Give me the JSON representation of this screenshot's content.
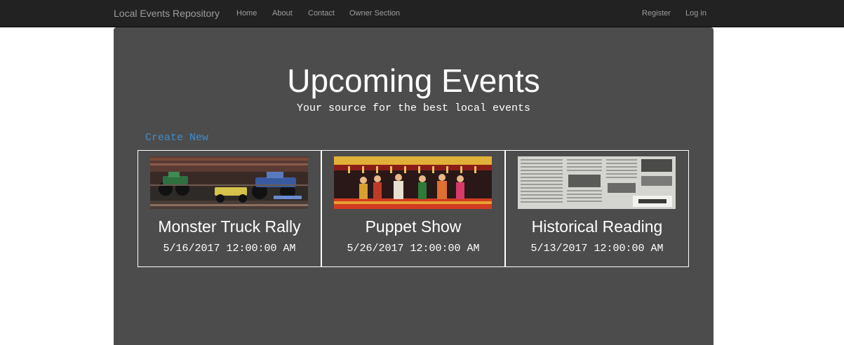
{
  "navbar": {
    "brand": "Local Events Repository",
    "links": [
      "Home",
      "About",
      "Contact",
      "Owner Section"
    ],
    "right_links": [
      "Register",
      "Log in"
    ]
  },
  "main": {
    "title": "Upcoming Events",
    "subtitle": "Your source for the best local events",
    "create_new": "Create New",
    "events": [
      {
        "name": "Monster Truck Rally",
        "date": "5/16/2017 12:00:00 AM",
        "image": "monster-truck-photo"
      },
      {
        "name": "Puppet Show",
        "date": "5/26/2017 12:00:00 AM",
        "image": "puppet-show-photo"
      },
      {
        "name": "Historical Reading",
        "date": "5/13/2017 12:00:00 AM",
        "image": "newspaper-photo"
      }
    ]
  },
  "colors": {
    "navbar_bg": "#222222",
    "nav_text": "#9d9d9d",
    "panel_bg": "#4c4c4c",
    "link": "#428bca",
    "text": "#ffffff"
  }
}
